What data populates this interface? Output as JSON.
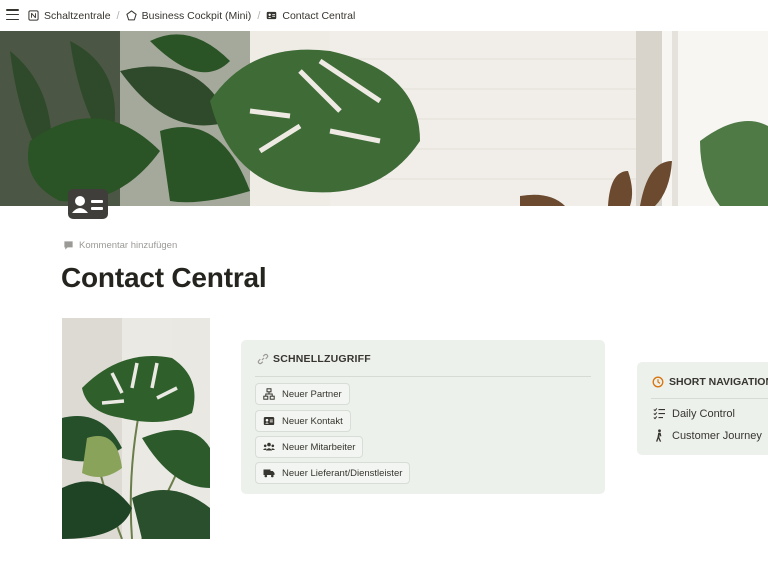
{
  "breadcrumbs": [
    {
      "label": "Schaltzentrale",
      "icon": "notion-logo-icon"
    },
    {
      "label": "Business Cockpit (Mini)",
      "icon": "pentagon-icon"
    },
    {
      "label": "Contact Central",
      "icon": "contact-card-icon"
    }
  ],
  "page": {
    "add_comment_label": "Kommentar hinzufügen",
    "title": "Contact Central"
  },
  "quick_access": {
    "heading": "SCHNELLZUGRIFF",
    "buttons": [
      {
        "label": "Neuer Partner",
        "icon": "org-chart-icon"
      },
      {
        "label": "Neuer Kontakt",
        "icon": "contact-card-icon"
      },
      {
        "label": "Neuer Mitarbeiter",
        "icon": "people-icon"
      },
      {
        "label": "Neuer Lieferant/Dienstleister",
        "icon": "truck-icon"
      }
    ]
  },
  "short_navigation": {
    "heading": "SHORT NAVIGATION",
    "links": [
      {
        "label": "Daily Control",
        "icon": "checklist-icon"
      },
      {
        "label": "Customer Journey",
        "icon": "walking-person-icon"
      }
    ]
  },
  "colors": {
    "callout_bg": "#edf1ec",
    "accent_orange": "#d9730d",
    "text": "#37352f"
  }
}
